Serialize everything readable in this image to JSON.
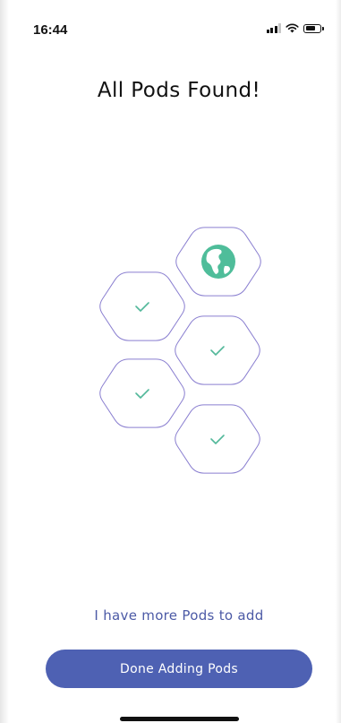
{
  "status_bar": {
    "time": "16:44",
    "signal_icon": "cellular-signal-icon",
    "wifi_icon": "wifi-icon",
    "battery_icon": "battery-icon",
    "battery_level": 0.7
  },
  "header": {
    "title": "All Pods Found!"
  },
  "illustration": {
    "pods": [
      {
        "state": "hub",
        "icon": "globe-icon"
      },
      {
        "state": "found",
        "icon": "checkmark-icon"
      },
      {
        "state": "found",
        "icon": "checkmark-icon"
      },
      {
        "state": "found",
        "icon": "checkmark-icon"
      },
      {
        "state": "found",
        "icon": "checkmark-icon"
      }
    ],
    "colors": {
      "outline": "#8a7fd0",
      "check": "#52b89a",
      "globe": "#4fbd9a"
    }
  },
  "actions": {
    "more_pods_label": "I have more Pods to add",
    "done_label": "Done Adding Pods"
  },
  "colors": {
    "accent": "#4e61b3",
    "link": "#4c5aa6"
  }
}
